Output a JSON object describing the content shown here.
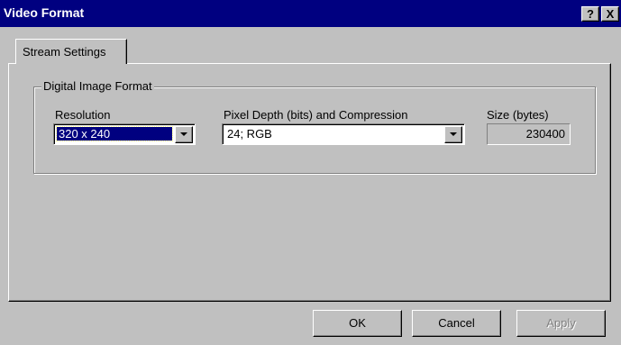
{
  "window": {
    "title": "Video Format",
    "help_label": "?",
    "close_label": "X"
  },
  "tabs": [
    {
      "label": "Stream Settings",
      "active": true
    }
  ],
  "group": {
    "label": "Digital Image Format"
  },
  "resolution": {
    "label": "Resolution",
    "value": "320 x 240"
  },
  "pixel_depth": {
    "label": "Pixel Depth (bits) and Compression",
    "value": "24; RGB"
  },
  "size": {
    "label": "Size (bytes)",
    "value": "230400"
  },
  "buttons": {
    "ok": "OK",
    "cancel": "Cancel",
    "apply": "Apply"
  },
  "colors": {
    "titlebar": "#000080",
    "face": "#c0c0c0",
    "selection": "#000080"
  }
}
